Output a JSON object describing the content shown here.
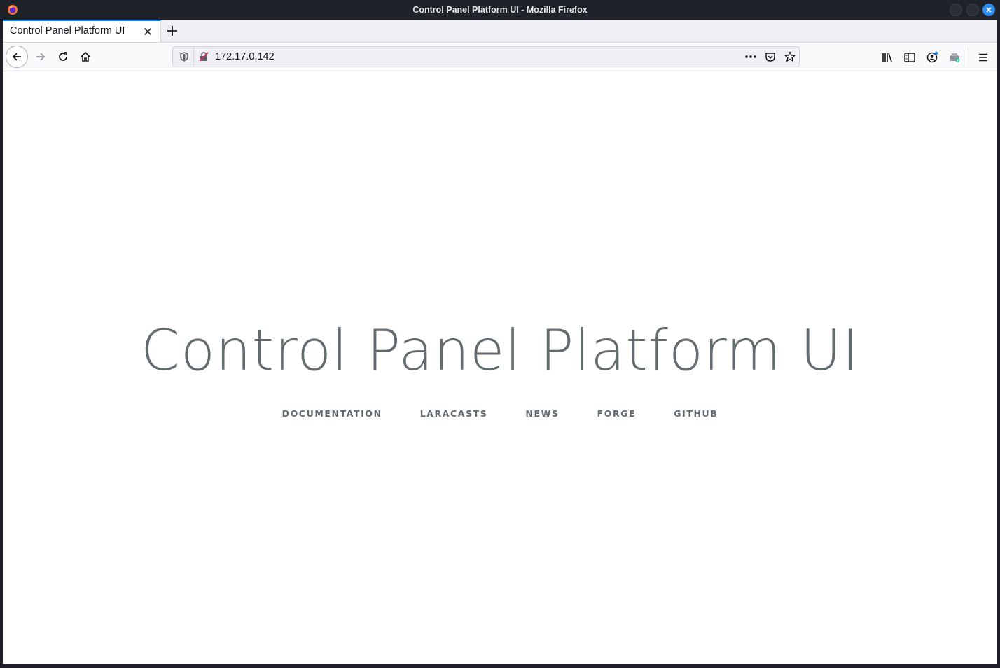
{
  "window": {
    "title": "Control Panel Platform UI - Mozilla Firefox"
  },
  "tabs": [
    {
      "label": "Control Panel Platform UI",
      "active": true
    }
  ],
  "navbar": {
    "url": "172.17.0.142"
  },
  "page": {
    "heading": "Control Panel Platform UI",
    "links": [
      {
        "label": "Documentation"
      },
      {
        "label": "Laracasts"
      },
      {
        "label": "News"
      },
      {
        "label": "Forge"
      },
      {
        "label": "GitHub"
      }
    ]
  },
  "colors": {
    "accent": "#0a84ff",
    "text_muted": "#636b6f",
    "window_bg": "#1f2229",
    "close_button": "#2d8cf0"
  },
  "icons": [
    "firefox-icon",
    "minimize-icon",
    "maximize-icon",
    "close-icon",
    "tab-close-icon",
    "new-tab-icon",
    "back-icon",
    "forward-icon",
    "reload-icon",
    "home-icon",
    "tracking-shield-icon",
    "insecure-lock-icon",
    "page-actions-icon",
    "pocket-icon",
    "bookmark-star-icon",
    "library-icon",
    "sidebar-icon",
    "account-icon",
    "extension-icon",
    "menu-icon"
  ]
}
